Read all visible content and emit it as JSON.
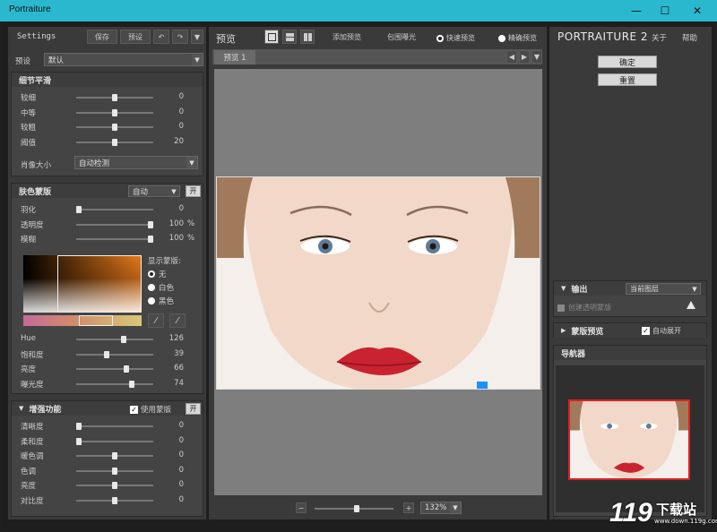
{
  "window": {
    "title": "Portraiture",
    "min": "—",
    "max": "☐",
    "close": "✕"
  },
  "left": {
    "settings_label": "Settings",
    "save": "保存",
    "preset": "预设",
    "undo": "↶",
    "redo": "↷",
    "menu": "▼",
    "preset_label": "预设",
    "preset_value": "默认",
    "detail": {
      "title": "细节平滑",
      "sliders": [
        {
          "label": "较细",
          "value": "0",
          "pos": 0.5
        },
        {
          "label": "中等",
          "value": "0",
          "pos": 0.5
        },
        {
          "label": "较粗",
          "value": "0",
          "pos": 0.5
        },
        {
          "label": "阈值",
          "value": "20",
          "pos": 0.5
        }
      ],
      "portrait_size_label": "肖像大小",
      "portrait_size_value": "自动检测"
    },
    "skin": {
      "title": "肤色蒙版",
      "mode": "自动",
      "toggle": "开",
      "sliders": [
        {
          "label": "羽化",
          "value": "0",
          "pct": "",
          "pos": 0.0
        },
        {
          "label": "透明度",
          "value": "100",
          "pct": "%",
          "pos": 1.0
        },
        {
          "label": "模糊",
          "value": "100",
          "pct": "%",
          "pos": 1.0
        }
      ],
      "show_mask_label": "显示蒙版:",
      "options": [
        "无",
        "白色",
        "黑色"
      ],
      "hsl": [
        {
          "label": "Hue",
          "value": "126",
          "pos": 0.63
        },
        {
          "label": "饱和度",
          "value": "39",
          "pos": 0.39
        },
        {
          "label": "亮度",
          "value": "66",
          "pos": 0.66
        },
        {
          "label": "曝光度",
          "value": "74",
          "pos": 0.74
        }
      ]
    },
    "enhance": {
      "title": "增强功能",
      "use_mask": "使用蒙版",
      "toggle": "开",
      "sliders": [
        {
          "label": "清晰度",
          "value": "0",
          "pos": 0.0
        },
        {
          "label": "柔和度",
          "value": "0",
          "pos": 0.0
        },
        {
          "label": "暖色调",
          "value": "0",
          "pos": 0.5
        },
        {
          "label": "色调",
          "value": "0",
          "pos": 0.5
        },
        {
          "label": "亮度",
          "value": "0",
          "pos": 0.5
        },
        {
          "label": "对比度",
          "value": "0",
          "pos": 0.5
        }
      ]
    }
  },
  "center": {
    "preview_label": "预览",
    "add_preview": "添加预览",
    "surround_exposure": "包围曝光",
    "fast_preview": "快速预览",
    "precise_preview": "精确预览",
    "tab": "预览 1",
    "zoom": "132%",
    "minus": "−",
    "plus": "+"
  },
  "right": {
    "brand": "PORTRAITURE 2",
    "about": "关于",
    "help": "帮助",
    "ok": "确定",
    "reset": "重置",
    "output": "输出",
    "output_value": "当前图层",
    "create_mask": "创建透明蒙版",
    "warn": "!",
    "mask_preview": "蒙版预览",
    "auto_expand": "自动展开",
    "navigator": "导航器"
  },
  "watermark": {
    "main": "下载站",
    "url": "www.down.119g.com"
  }
}
